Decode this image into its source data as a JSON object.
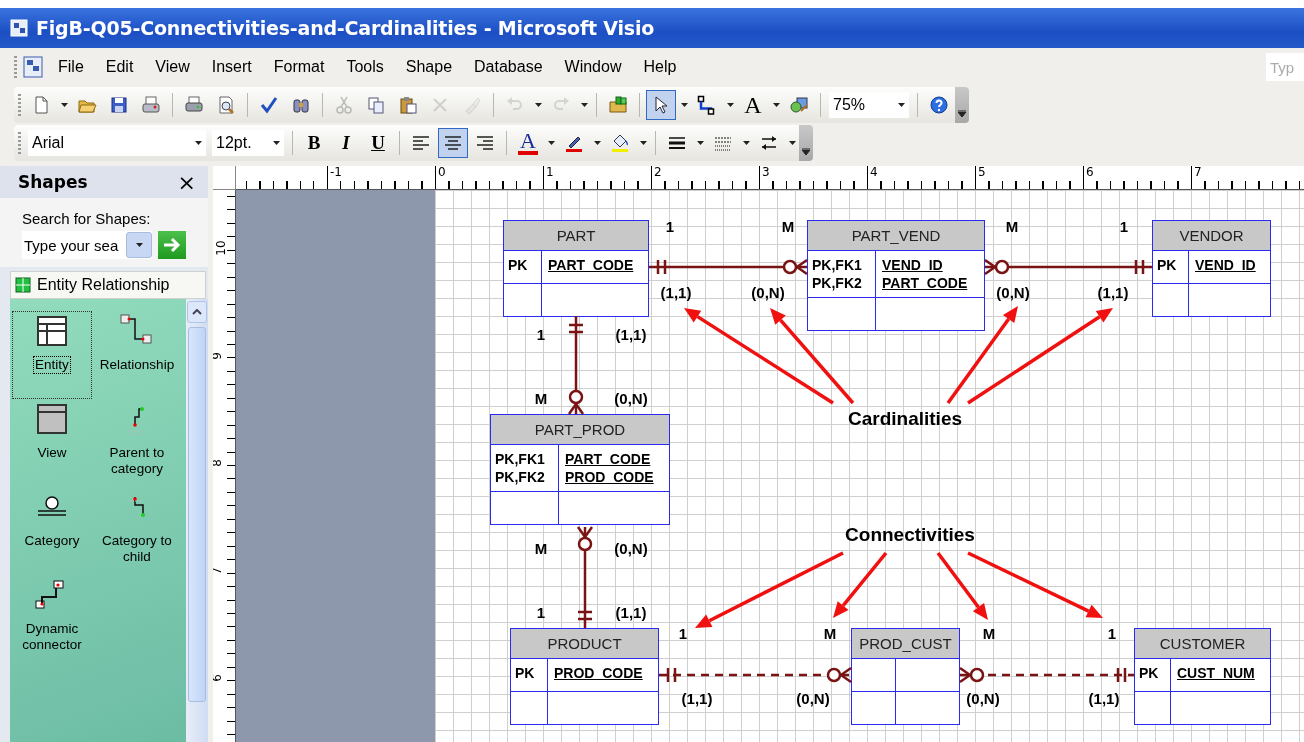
{
  "window": {
    "title": "FigB-Q05-Connectivities-and-Cardinalities - Microsoft Visio"
  },
  "menu_bar": {
    "items": [
      "File",
      "Edit",
      "View",
      "Insert",
      "Format",
      "Tools",
      "Shape",
      "Database",
      "Window",
      "Help"
    ],
    "help_placeholder": "Typ"
  },
  "standard_toolbar": {
    "buttons": [
      {
        "kind": "new",
        "selected": false,
        "disabled": false
      },
      {
        "kind": "open",
        "selected": false,
        "disabled": false
      },
      {
        "kind": "save",
        "selected": false,
        "disabled": false
      },
      {
        "kind": "permission",
        "selected": false,
        "disabled": false
      },
      {
        "kind": "print",
        "selected": false,
        "disabled": false
      },
      {
        "kind": "preview",
        "selected": false,
        "disabled": false
      },
      {
        "kind": "spelling",
        "selected": false,
        "disabled": false
      },
      {
        "kind": "research",
        "selected": false,
        "disabled": false
      },
      {
        "kind": "cut",
        "selected": false,
        "disabled": true
      },
      {
        "kind": "copy",
        "selected": false,
        "disabled": false
      },
      {
        "kind": "paste",
        "selected": false,
        "disabled": false
      },
      {
        "kind": "delete",
        "selected": false,
        "disabled": true
      },
      {
        "kind": "painter",
        "selected": false,
        "disabled": true
      },
      {
        "kind": "undo",
        "selected": false,
        "disabled": true
      },
      {
        "kind": "redo",
        "selected": false,
        "disabled": true
      },
      {
        "kind": "stencil",
        "selected": false,
        "disabled": false
      },
      {
        "kind": "pointer",
        "selected": true,
        "disabled": false
      },
      {
        "kind": "connector",
        "selected": false,
        "disabled": false
      },
      {
        "kind": "text",
        "label": "A",
        "selected": false,
        "disabled": false
      },
      {
        "kind": "fill",
        "selected": false,
        "disabled": false
      },
      {
        "kind": "zoom",
        "value": "75%",
        "selected": false,
        "disabled": false
      },
      {
        "kind": "help",
        "selected": false,
        "disabled": false
      }
    ]
  },
  "formatting_toolbar": {
    "font": "Arial",
    "size": "12pt.",
    "buttons": [
      {
        "kind": "bold",
        "label": "B",
        "selected": false
      },
      {
        "kind": "italic",
        "label": "I",
        "selected": false
      },
      {
        "kind": "underline",
        "label": "U",
        "selected": false
      },
      {
        "kind": "align-left",
        "selected": false
      },
      {
        "kind": "align-center",
        "selected": true
      },
      {
        "kind": "align-right",
        "selected": false
      },
      {
        "kind": "font-color",
        "label": "A",
        "selected": false
      },
      {
        "kind": "line-color",
        "selected": false
      },
      {
        "kind": "fill-color",
        "selected": false
      },
      {
        "kind": "line-weight",
        "selected": false
      },
      {
        "kind": "line-pattern",
        "selected": false
      },
      {
        "kind": "line-ends",
        "selected": false
      }
    ]
  },
  "shapes_panel": {
    "title": "Shapes",
    "close": "×",
    "search_label": "Search for Shapes:",
    "search_placeholder": "Type your sea",
    "stencil": "Entity Relationship",
    "shapes": [
      {
        "kind": "entity",
        "label": "Entity",
        "selected": true
      },
      {
        "kind": "relationship",
        "label": "Relationship",
        "selected": false
      },
      {
        "kind": "view",
        "label": "View",
        "selected": false
      },
      {
        "kind": "parent",
        "label": "Parent to category",
        "selected": false
      },
      {
        "kind": "category",
        "label": "Category",
        "selected": false
      },
      {
        "kind": "child",
        "label": "Category to child",
        "selected": false
      },
      {
        "kind": "dynamic",
        "label": "Dynamic connector",
        "selected": false
      }
    ]
  },
  "rulers": {
    "horizontal": [
      "-1",
      "0",
      "1",
      "2",
      "3",
      "4",
      "5",
      "6",
      "7"
    ],
    "vertical": [
      "10",
      "9",
      "8",
      "7",
      "6"
    ]
  },
  "diagram": {
    "entities": [
      {
        "name": "PART",
        "rows": [
          {
            "keys": [
              "PK"
            ],
            "fields": [
              "PART_CODE"
            ]
          },
          {}
        ]
      },
      {
        "name": "PART_VEND",
        "rows": [
          {
            "keys": [
              "PK,FK1",
              "PK,FK2"
            ],
            "fields": [
              "VEND_ID",
              "PART_CODE"
            ]
          },
          {}
        ]
      },
      {
        "name": "VENDOR",
        "rows": [
          {
            "keys": [
              "PK"
            ],
            "fields": [
              "VEND_ID"
            ]
          },
          {}
        ]
      },
      {
        "name": "PART_PROD",
        "rows": [
          {
            "keys": [
              "PK,FK1",
              "PK,FK2"
            ],
            "fields": [
              "PART_CODE",
              "PROD_CODE"
            ]
          },
          {}
        ]
      },
      {
        "name": "PRODUCT",
        "rows": [
          {
            "keys": [
              "PK"
            ],
            "fields": [
              "PROD_CODE"
            ]
          },
          {}
        ]
      },
      {
        "name": "PROD_CUST",
        "rows": [
          {},
          {}
        ]
      },
      {
        "name": "CUSTOMER",
        "rows": [
          {
            "keys": [
              "PK"
            ],
            "fields": [
              "CUST_NUM"
            ]
          },
          {}
        ]
      }
    ],
    "relationships": [
      {
        "dashed": false,
        "ends": [
          {
            "kind": "one"
          },
          {
            "kind": "zero-many"
          }
        ]
      },
      {
        "dashed": false,
        "ends": [
          {
            "kind": "zero-many"
          },
          {
            "kind": "one"
          }
        ]
      },
      {
        "dashed": false,
        "ends": [
          {
            "kind": "one"
          },
          {
            "kind": "zero-many"
          }
        ]
      },
      {
        "dashed": false,
        "ends": [
          {
            "kind": "zero-many"
          },
          {
            "kind": "one"
          }
        ]
      },
      {
        "dashed": true,
        "ends": [
          {
            "kind": "one"
          },
          {
            "kind": "zero-many"
          }
        ]
      },
      {
        "dashed": true,
        "ends": [
          {
            "kind": "zero-many"
          },
          {
            "kind": "one"
          }
        ]
      }
    ],
    "labels": [
      "1",
      "M",
      "M",
      "1",
      "(1,1)",
      "(0,N)",
      "(0,N)",
      "(1,1)",
      "1",
      "(1,1)",
      "M",
      "(0,N)",
      "M",
      "(0,N)",
      "1",
      "(1,1)",
      "1",
      "M",
      "M",
      "1",
      "(1,1)",
      "(0,N)",
      "(0,N)",
      "(1,1)"
    ],
    "callouts": [
      {
        "text": "Cardinalities"
      },
      {
        "text": "Connectivities"
      }
    ]
  }
}
